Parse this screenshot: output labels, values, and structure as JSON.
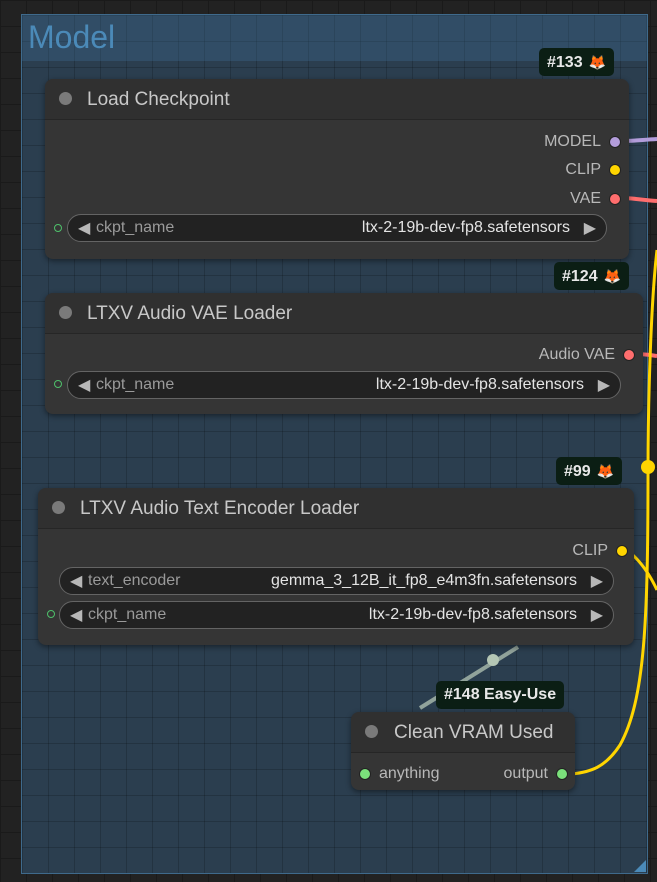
{
  "group": {
    "title": "Model"
  },
  "nodes": {
    "load_checkpoint": {
      "badge": "#133",
      "title": "Load Checkpoint",
      "outputs": [
        "MODEL",
        "CLIP",
        "VAE"
      ],
      "widget": {
        "name": "ckpt_name",
        "value": "ltx-2-19b-dev-fp8.safetensors"
      }
    },
    "audio_vae_loader": {
      "badge": "#124",
      "title": "LTXV Audio VAE Loader",
      "outputs": [
        "Audio VAE"
      ],
      "widget": {
        "name": "ckpt_name",
        "value": "ltx-2-19b-dev-fp8.safetensors"
      }
    },
    "audio_text_encoder_loader": {
      "badge": "#99",
      "title": "LTXV Audio Text Encoder Loader",
      "outputs": [
        "CLIP"
      ],
      "widgets": [
        {
          "name": "text_encoder",
          "value": "gemma_3_12B_it_fp8_e4m3fn.safetensors"
        },
        {
          "name": "ckpt_name",
          "value": "ltx-2-19b-dev-fp8.safetensors"
        }
      ]
    },
    "clean_vram": {
      "badge": "#148 Easy-Use",
      "title": "Clean VRAM Used",
      "input": "anything",
      "output": "output"
    }
  },
  "colors": {
    "model": "#b39ddb",
    "clip": "#ffd500",
    "vae": "#ff6e6e",
    "any": "#7be07b",
    "group_title": "#4b8ab8"
  },
  "icons": {
    "badge_icon": "fox-icon"
  }
}
